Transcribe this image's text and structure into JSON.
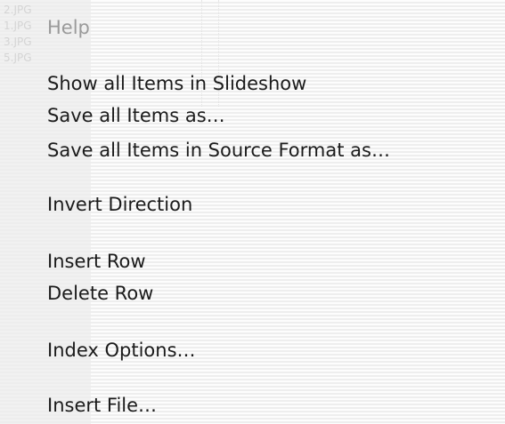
{
  "background_files": [
    "2.JPG",
    "1.JPG",
    "3.JPG",
    "5.JPG"
  ],
  "menu": {
    "header": "Help",
    "items": [
      "Show all Items in Slideshow",
      "Save all Items as…",
      "Save all Items in Source Format as…",
      "Invert Direction",
      "Insert Row",
      "Delete Row",
      "Index Options…",
      "Insert File…"
    ]
  }
}
